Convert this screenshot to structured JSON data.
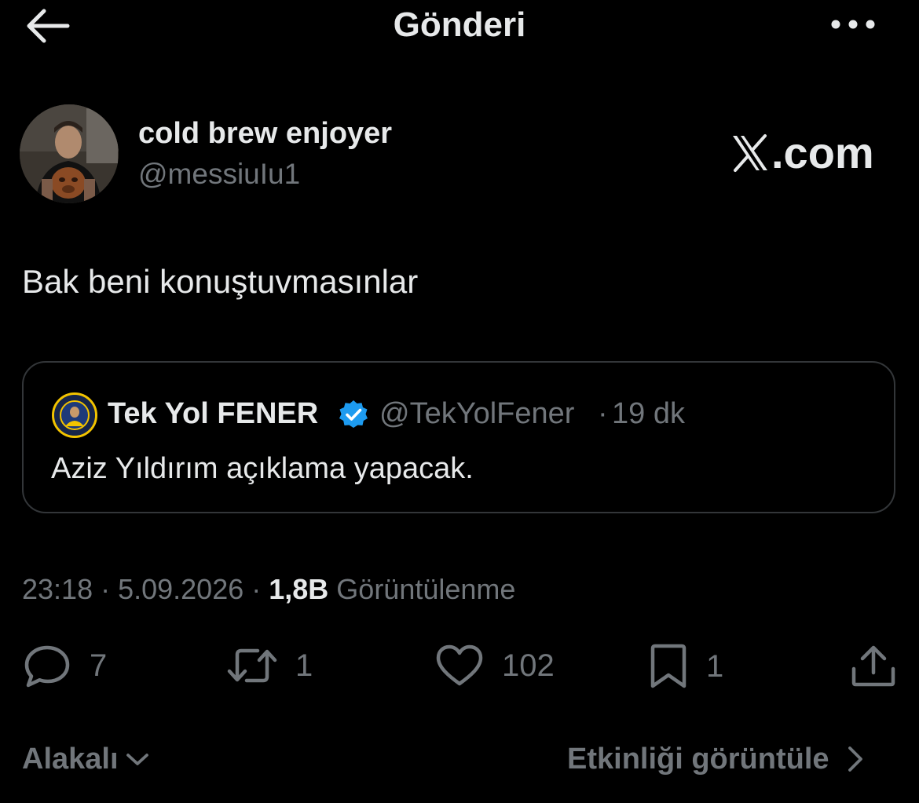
{
  "header": {
    "title": "Gönderi"
  },
  "author": {
    "display_name": "cold brew enjoyer",
    "handle": "@messiuIu1"
  },
  "watermark": {
    "text": ".com"
  },
  "tweet": {
    "text": "Bak beni konuştuvmasınlar"
  },
  "quote": {
    "name": "Tek Yol FENER",
    "handle": "@TekYolFener",
    "separator": "·",
    "time": "19 dk",
    "text": "Aziz Yıldırım açıklama yapacak."
  },
  "meta": {
    "time": "23:18",
    "sep1": " · ",
    "date": "5.09.2026",
    "sep2": " · ",
    "views": "1,8B",
    "views_label": " Görüntülenme"
  },
  "actions": {
    "replies": "7",
    "reposts": "1",
    "likes": "102",
    "bookmarks": "1"
  },
  "footer": {
    "sort_label": "Alakalı",
    "activity_label": "Etkinliği görüntüle"
  },
  "colors": {
    "background": "#000000",
    "text_primary": "#e7e9ea",
    "text_secondary": "#71767b",
    "border": "#333639",
    "verified": "#1d9bf0"
  },
  "icons": {
    "back": "arrow-left-icon",
    "more": "more-horizontal-icon",
    "verified": "verified-badge-icon",
    "reply": "comment-icon",
    "repost": "repost-icon",
    "like": "heart-icon",
    "bookmark": "bookmark-icon",
    "share": "share-icon",
    "chevron_down": "chevron-down-icon",
    "chevron_right": "chevron-right-icon"
  }
}
